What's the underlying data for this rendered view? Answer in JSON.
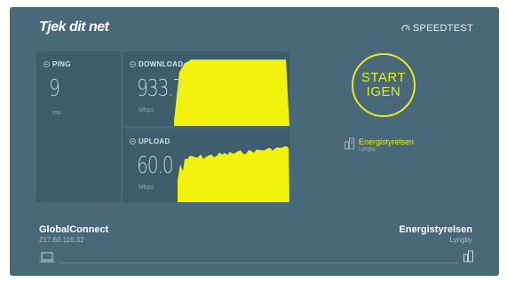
{
  "brand": "Tjek dit net",
  "speedtest_label": "SPEEDTEST",
  "ping": {
    "label": "PING",
    "value": "9",
    "unit": "ms"
  },
  "download": {
    "label": "DOWNLOAD",
    "value": "933.7",
    "unit": "Mbps",
    "graph_fill_fraction": 0.89
  },
  "upload": {
    "label": "UPLOAD",
    "value": "60.0",
    "unit": "Mbps",
    "graph_fill_fraction": 0.78
  },
  "start_button": {
    "line1": "START",
    "line2": "IGEN"
  },
  "server": {
    "name": "Energistyrelsen",
    "location": "Lyngby"
  },
  "isp": {
    "name": "GlobalConnect",
    "ip": "217.63.116.32"
  },
  "host": {
    "name": "Energistyrelsen",
    "location": "Lyngby"
  },
  "colors": {
    "background": "#47697a",
    "panel": "#3e5e6e",
    "accent": "#e8ea1e"
  },
  "icons": [
    "speedtest-gauge-icon",
    "ping-icon",
    "download-icon",
    "upload-icon",
    "server-icon",
    "laptop-icon"
  ]
}
